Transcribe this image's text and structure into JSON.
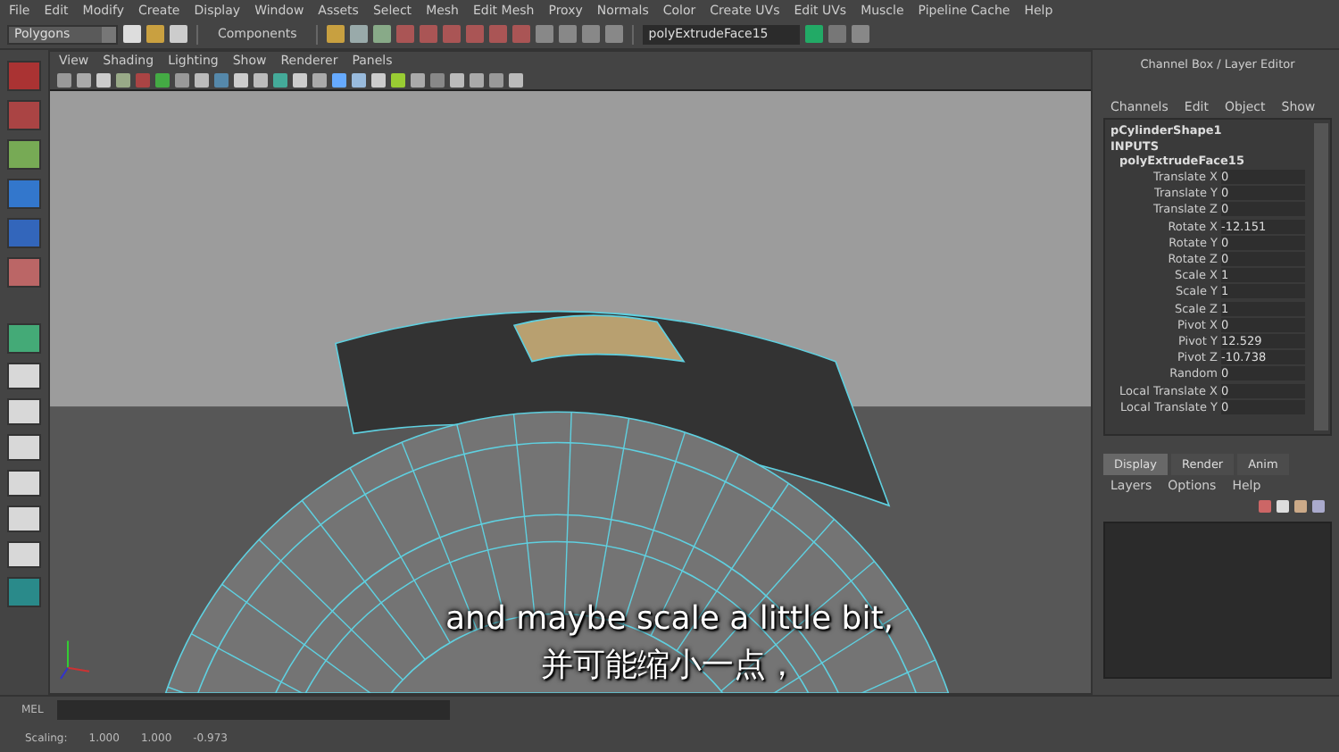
{
  "menu_bar": [
    "File",
    "Edit",
    "Modify",
    "Create",
    "Display",
    "Window",
    "Assets",
    "Select",
    "Mesh",
    "Edit Mesh",
    "Proxy",
    "Normals",
    "Color",
    "Create UVs",
    "Edit UVs",
    "Muscle",
    "Pipeline Cache",
    "Help"
  ],
  "toolbar": {
    "mode": "Polygons",
    "components_label": "Components",
    "object_field": "polyExtrudeFace15"
  },
  "viewport": {
    "menu": [
      "View",
      "Shading",
      "Lighting",
      "Show",
      "Renderer",
      "Panels"
    ]
  },
  "channel_box": {
    "title": "Channel Box / Layer Editor",
    "menu": [
      "Channels",
      "Edit",
      "Object",
      "Show"
    ],
    "object": "pCylinderShape1",
    "section": "INPUTS",
    "node": "polyExtrudeFace15",
    "attributes": [
      {
        "name": "Translate X",
        "value": "0"
      },
      {
        "name": "Translate Y",
        "value": "0"
      },
      {
        "name": "Translate Z",
        "value": "0"
      },
      {
        "name": "Rotate X",
        "value": "-12.151"
      },
      {
        "name": "Rotate Y",
        "value": "0"
      },
      {
        "name": "Rotate Z",
        "value": "0"
      },
      {
        "name": "Scale X",
        "value": "1"
      },
      {
        "name": "Scale Y",
        "value": "1"
      },
      {
        "name": "Scale Z",
        "value": "1"
      },
      {
        "name": "Pivot X",
        "value": "0"
      },
      {
        "name": "Pivot Y",
        "value": "12.529"
      },
      {
        "name": "Pivot Z",
        "value": "-10.738"
      },
      {
        "name": "Random",
        "value": "0"
      },
      {
        "name": "Local Translate X",
        "value": "0"
      },
      {
        "name": "Local Translate Y",
        "value": "0"
      }
    ]
  },
  "layer_editor": {
    "tabs": [
      {
        "label": "Display",
        "selected": true
      },
      {
        "label": "Render",
        "selected": false
      },
      {
        "label": "Anim",
        "selected": false
      }
    ],
    "menu": [
      "Layers",
      "Options",
      "Help"
    ]
  },
  "command_line": {
    "label": "MEL"
  },
  "status": {
    "label": "Scaling:",
    "values": [
      "1.000",
      "1.000",
      "-0.973"
    ]
  },
  "subtitles": [
    "and maybe scale a little bit,",
    "并可能缩小一点，"
  ]
}
